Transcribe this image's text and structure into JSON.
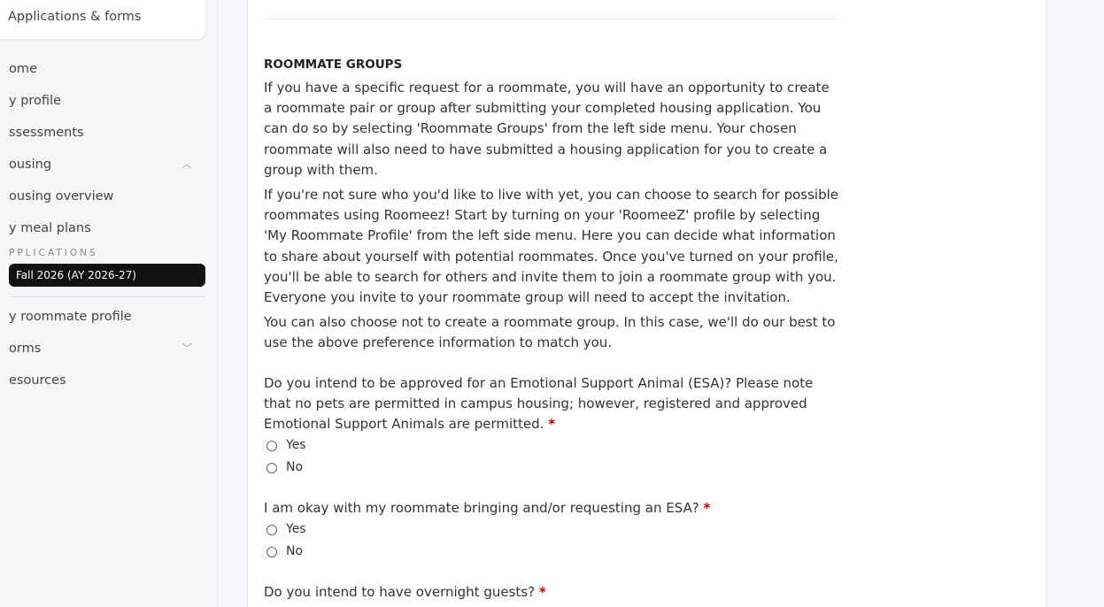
{
  "sidebar": {
    "header_label": "Applications & forms",
    "items": [
      {
        "label": "ome"
      },
      {
        "label": "y profile"
      },
      {
        "label": "ssessments"
      },
      {
        "label": "ousing",
        "chevron": "chevron-up-icon"
      },
      {
        "label": "ousing overview"
      },
      {
        "label": "y meal plans"
      }
    ],
    "section_label": "PPLICATIONS",
    "active_item": "Fall 2026 (AY 2026-27)",
    "items_after": [
      {
        "label": "y roommate profile"
      },
      {
        "label": "orms",
        "chevron": "chevron-down-icon"
      },
      {
        "label": "esources"
      }
    ]
  },
  "main": {
    "section_title": "ROOMMATE GROUPS",
    "paragraphs": [
      "If you have a specific request for a roommate, you will have an opportunity to create a roommate pair or group after submitting your completed housing application. You can do so by selecting 'Roommate Groups' from the left side menu. Your chosen roommate will also need to have submitted a housing application for you to create a group with them.",
      "If you're not sure who you'd like to live with yet, you can choose to search for possible roommates using Roomeez! Start by turning on your 'RoomeeZ' profile by selecting 'My Roommate Profile' from the left side menu. Here you can decide what information to share about yourself with potential roommates. Once you've turned on your profile, you'll be able to search for others and invite them to join a roommate group with you. Everyone you invite to your roommate group will need to accept the invitation.",
      "You can also choose not to create a roommate group. In this case, we'll do our best to use the above preference information to match you."
    ],
    "questions": [
      {
        "text": "Do you intend to be approved for an Emotional Support Animal (ESA)? Please note that no pets are permitted in campus housing; however, registered and approved Emotional Support Animals are permitted.",
        "required_mark": "*",
        "options": [
          "Yes",
          "No"
        ]
      },
      {
        "text": "I am okay with my roommate bringing and/or requesting an ESA?",
        "required_mark": "*",
        "options": [
          "Yes",
          "No"
        ]
      },
      {
        "text": "Do you intend to have overnight guests?",
        "required_mark": "*",
        "options": []
      }
    ]
  }
}
